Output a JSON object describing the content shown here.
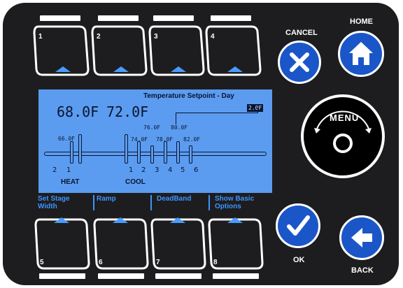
{
  "softkeys_top": [
    {
      "number": "1"
    },
    {
      "number": "2"
    },
    {
      "number": "3"
    },
    {
      "number": "4"
    }
  ],
  "softkeys_bottom": [
    {
      "number": "5"
    },
    {
      "number": "6"
    },
    {
      "number": "7"
    },
    {
      "number": "8"
    }
  ],
  "screen": {
    "title": "Temperature Setpoint - Day",
    "heat_setpoint": "68.0F",
    "cool_setpoint": "72.0F",
    "deadband_value": "2.0F",
    "heat_stage_temp": "66.0F",
    "cool_stage_temps": [
      "74.0F",
      "76.0F",
      "78.0F",
      "80.0F",
      "82.0F"
    ],
    "heat_stages": [
      "2",
      "1"
    ],
    "cool_stages": [
      "1",
      "2",
      "3",
      "4",
      "5",
      "6"
    ],
    "heat_label": "HEAT",
    "cool_label": "COOL"
  },
  "soft_labels": {
    "label_1_line1": "Set Stage",
    "label_1_line2": "Width",
    "label_2": "Ramp",
    "label_3": "DeadBand",
    "label_4_line1": "Show Basic",
    "label_4_line2": "Options"
  },
  "buttons": {
    "cancel_label": "CANCEL",
    "home_label": "HOME",
    "menu_label": "MENU",
    "ok_label": "OK",
    "back_label": "BACK"
  },
  "colors": {
    "panel": "#1d1d1f",
    "lcd": "#5b9cf0",
    "button_blue": "#1b56c8",
    "key_accent": "#4a9cff",
    "label_blue": "#3e93ff"
  },
  "icons": {
    "cancel": "x-icon",
    "home": "house-icon",
    "menu": "circle-icon",
    "ok": "checkmark-icon",
    "back": "left-arrow-icon"
  }
}
